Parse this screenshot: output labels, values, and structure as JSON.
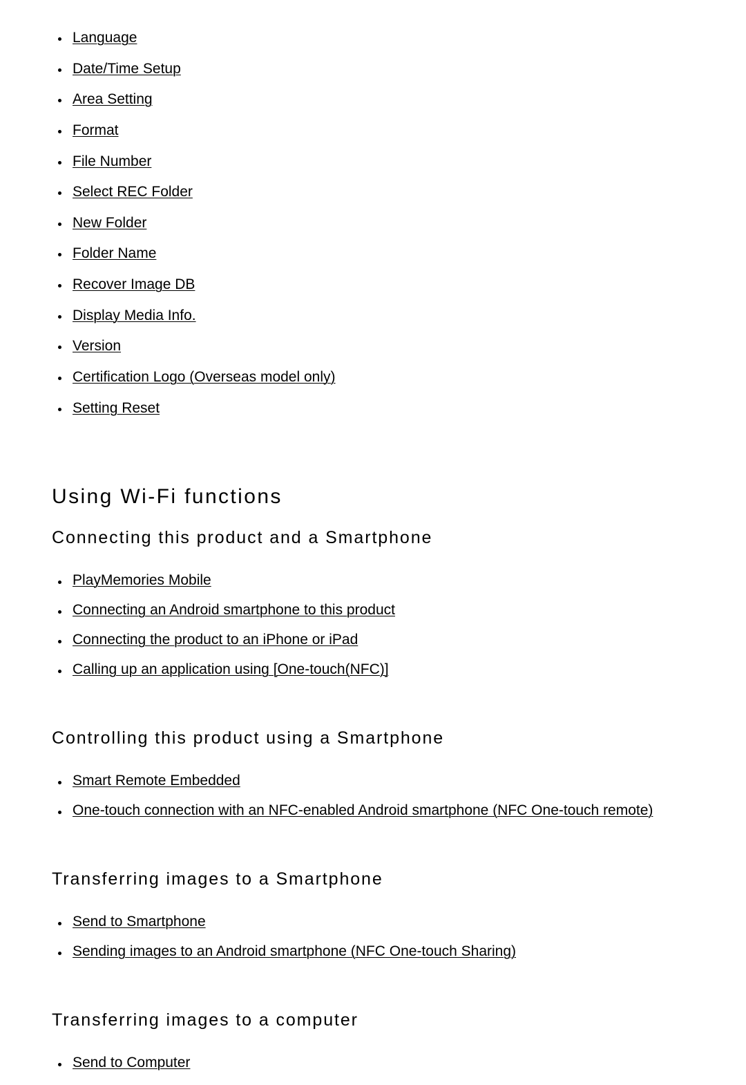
{
  "document": {
    "settings_list": [
      {
        "label": "Language "
      },
      {
        "label": "Date/Time Setup"
      },
      {
        "label": "Area Setting"
      },
      {
        "label": "Format"
      },
      {
        "label": "File Number"
      },
      {
        "label": "Select REC Folder"
      },
      {
        "label": "New Folder"
      },
      {
        "label": "Folder Name"
      },
      {
        "label": "Recover Image DB"
      },
      {
        "label": "Display Media Info."
      },
      {
        "label": "Version"
      },
      {
        "label": "Certification Logo (Overseas model only)"
      },
      {
        "label": "Setting Reset"
      }
    ],
    "wifi": {
      "title": "Using Wi-Fi functions",
      "sections": [
        {
          "heading": "Connecting this product and a Smartphone",
          "items": [
            {
              "label": "PlayMemories Mobile"
            },
            {
              "label": "Connecting an Android smartphone to this product"
            },
            {
              "label": "Connecting the product to an iPhone or iPad"
            },
            {
              "label": "Calling up an application using [One-touch(NFC)]"
            }
          ]
        },
        {
          "heading": "Controlling this product using a Smartphone",
          "items": [
            {
              "label": "Smart Remote Embedded"
            },
            {
              "label": "One-touch connection with an NFC-enabled Android smartphone (NFC One-touch remote)"
            }
          ]
        },
        {
          "heading": "Transferring images to a Smartphone",
          "items": [
            {
              "label": "Send to Smartphone"
            },
            {
              "label": "Sending images to an Android smartphone (NFC One-touch Sharing)"
            }
          ]
        },
        {
          "heading": "Transferring images to a computer",
          "items": [
            {
              "label": "Send to Computer"
            }
          ]
        }
      ]
    },
    "colors": {
      "text": "#000000",
      "background": "#ffffff"
    }
  }
}
